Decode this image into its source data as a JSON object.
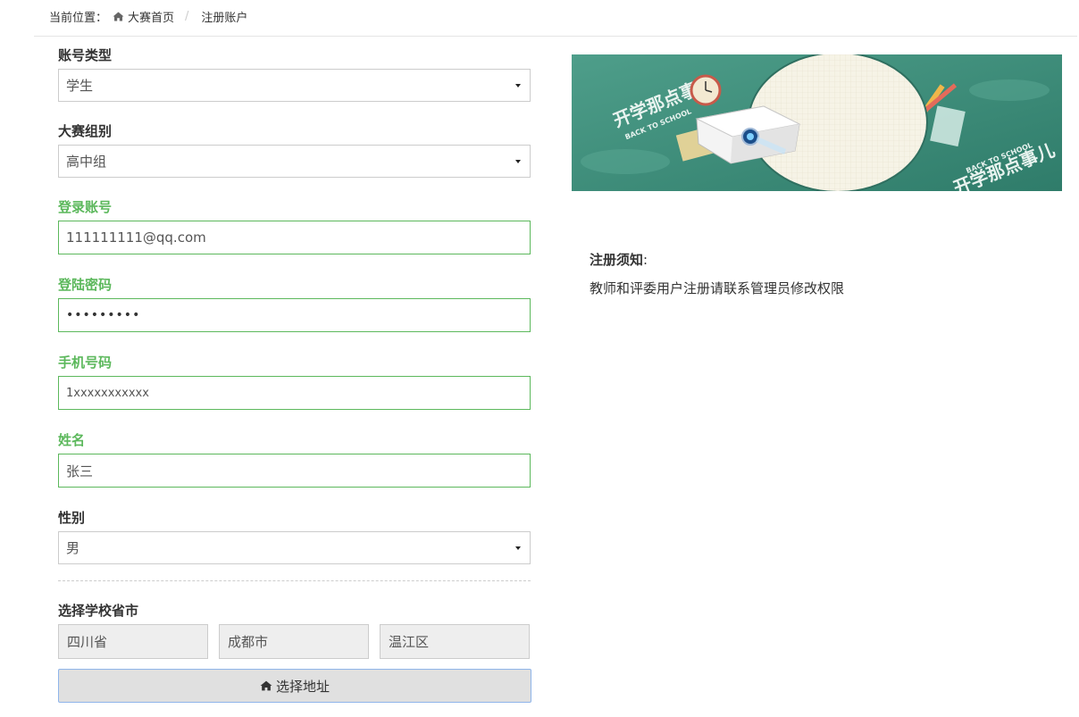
{
  "breadcrumb": {
    "prefix": "当前位置：",
    "home": "大赛首页",
    "separator": "/",
    "current": "注册账户"
  },
  "form": {
    "account_type": {
      "label": "账号类型",
      "value": "学生"
    },
    "competition_group": {
      "label": "大赛组别",
      "value": "高中组"
    },
    "login_account": {
      "label": "登录账号",
      "value": "111111111@qq.com"
    },
    "password": {
      "label": "登陆密码",
      "value": "•••••••••"
    },
    "phone": {
      "label": "手机号码",
      "value": "1xxxxxxxxxxx"
    },
    "name": {
      "label": "姓名",
      "value": "张三"
    },
    "gender": {
      "label": "性别",
      "value": "男"
    },
    "school_location": {
      "label": "选择学校省市",
      "province": "四川省",
      "city": "成都市",
      "district": "温江区"
    },
    "choose_address_button": "选择地址"
  },
  "banner": {
    "text_top": "开学那点事儿",
    "text_sub_top": "BACK TO SCHOOL",
    "text_bottom": "开学那点事儿",
    "text_sub_bottom": "BACK TO SCHOOL"
  },
  "notice": {
    "title": "注册须知",
    "colon": ":",
    "text": "教师和评委用户注册请联系管理员修改权限"
  },
  "colors": {
    "valid_green": "#5cb85c",
    "banner_teal": "#3f8f7c"
  },
  "icons": {
    "home": "home-icon",
    "caret": "caret-down-icon"
  }
}
